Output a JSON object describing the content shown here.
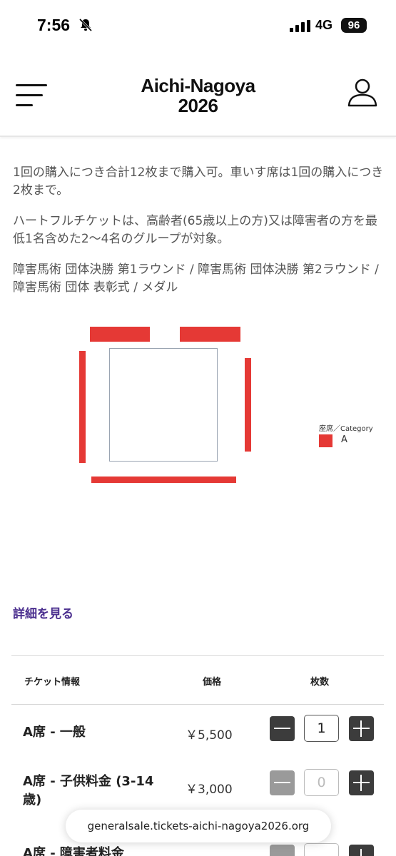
{
  "status_bar": {
    "time": "7:56",
    "network": "4G",
    "battery": "96"
  },
  "header": {
    "brand_line1": "Aichi-Nagoya",
    "brand_line2": "2026"
  },
  "info": {
    "purchase_limit": "1回の購入につき合計12枚まで購入可。車いす席は1回の購入につき2枚まで。",
    "heartful": "ハートフルチケットは、高齢者(65歳以上の方)又は障害者の方を最低1名含めた2～4名のグループが対象。",
    "events": "障害馬術 団体決勝 第1ラウンド / 障害馬術 団体決勝 第2ラウンド / 障害馬術 団体 表彰式 / メダル"
  },
  "seatmap": {
    "legend_title": "座席／Category",
    "legend_label": "A",
    "seat_color": "#e53935"
  },
  "details_link": "詳細を見る",
  "table": {
    "headers": {
      "ticket": "チケット情報",
      "price": "価格",
      "qty": "枚数"
    },
    "rows": [
      {
        "name": "A席 - 一般",
        "price": "￥5,500",
        "qty": "1"
      },
      {
        "name": "A席 - 子供料金 (3-14歳)",
        "price": "￥3,000",
        "qty": "0"
      },
      {
        "name": "A席 - 障害者料金",
        "price": "",
        "qty": ""
      }
    ]
  },
  "url": "generalsale.tickets-aichi-nagoya2026.org"
}
